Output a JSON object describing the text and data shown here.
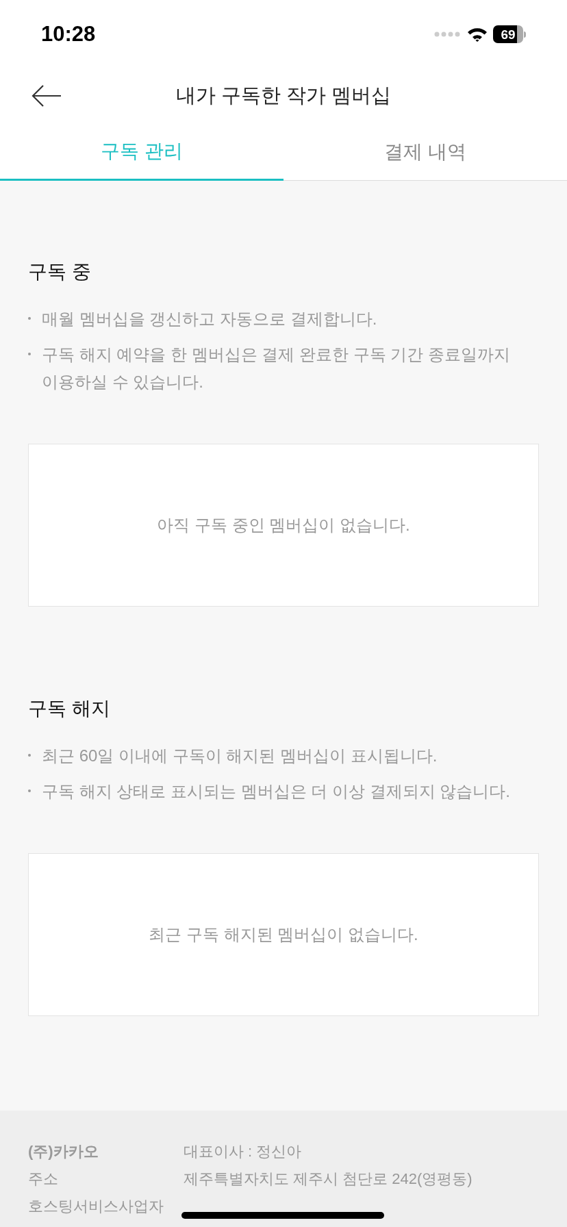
{
  "status_bar": {
    "time": "10:28",
    "battery": "69"
  },
  "header": {
    "title": "내가 구독한 작가 멤버십"
  },
  "tabs": [
    {
      "label": "구독 관리",
      "selected": true
    },
    {
      "label": "결제 내역",
      "selected": false
    }
  ],
  "sections": [
    {
      "title": "구독 중",
      "notes": [
        "매월 멤버십을 갱신하고 자동으로 결제합니다.",
        "구독 해지 예약을 한 멤버십은 결제 완료한 구독 기간 종료일까지 이용하실 수 있습니다."
      ],
      "empty_message": "아직 구독 중인 멤버십이 없습니다."
    },
    {
      "title": "구독 해지",
      "notes": [
        "최근 60일 이내에 구독이 해지된 멤버십이 표시됩니다.",
        "구독 해지 상태로 표시되는 멤버십은 더 이상 결제되지 않습니다."
      ],
      "empty_message": "최근 구독 해지된 멤버십이 없습니다."
    }
  ],
  "footer": {
    "rows": [
      {
        "label": "(주)카카오",
        "value": "대표이사 : 정신아",
        "bold": true
      },
      {
        "label": "주소",
        "value": "제주특별자치도 제주시 첨단로 242(영평동)",
        "bold": false
      },
      {
        "label": "호스팅서비스사업자",
        "bold": false
      }
    ]
  }
}
